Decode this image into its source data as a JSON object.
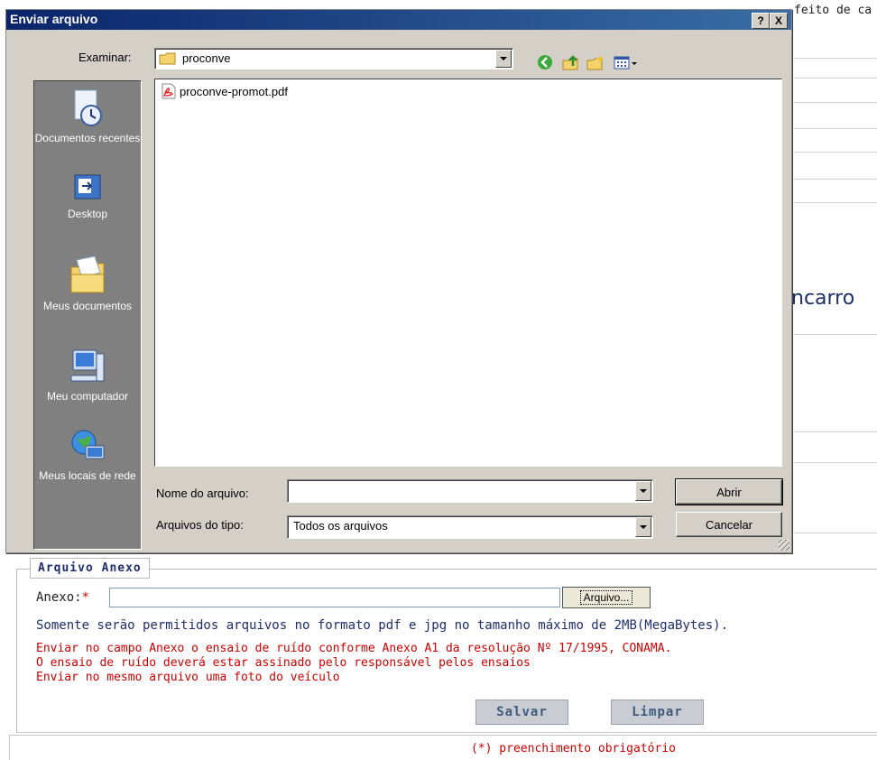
{
  "background": {
    "top_right_text": "feito de ca",
    "mid_right_text": "ncarro",
    "fieldset_legend": "Arquivo Anexo",
    "anexo_label": "Anexo:",
    "required_mark": "*",
    "arquivo_button": "Arquivo...",
    "info_blue": "Somente serão permitidos arquivos no formato pdf e jpg no tamanho máximo de 2MB(MegaBytes).",
    "info_red_1": "Enviar no campo Anexo o ensaio de ruído conforme Anexo A1 da resolução Nº 17/1995, CONAMA.",
    "info_red_2": "O ensaio de ruído deverá estar assinado pelo responsável pelos ensaios",
    "info_red_3": "Enviar no mesmo arquivo uma foto do veículo",
    "salvar_button": "Salvar",
    "limpar_button": "Limpar",
    "footer_note": "(*) preenchimento obrigatório"
  },
  "dialog": {
    "title": "Enviar arquivo",
    "help_button": "?",
    "close_button": "X",
    "look_in_label": "Examinar:",
    "look_in_value": "proconve",
    "places": [
      {
        "label": "Documentos recentes",
        "icon": "recent-documents-icon"
      },
      {
        "label": "Desktop",
        "icon": "desktop-icon"
      },
      {
        "label": "Meus documentos",
        "icon": "my-documents-icon"
      },
      {
        "label": "Meu computador",
        "icon": "my-computer-icon"
      },
      {
        "label": "Meus locais de rede",
        "icon": "network-places-icon"
      }
    ],
    "files": [
      {
        "name": "proconve-promot.pdf",
        "icon": "pdf-file-icon"
      }
    ],
    "filename_label": "Nome do arquivo:",
    "filename_value": "",
    "filetype_label": "Arquivos do tipo:",
    "filetype_value": "Todos os arquivos",
    "open_button": "Abrir",
    "cancel_button": "Cancelar"
  }
}
